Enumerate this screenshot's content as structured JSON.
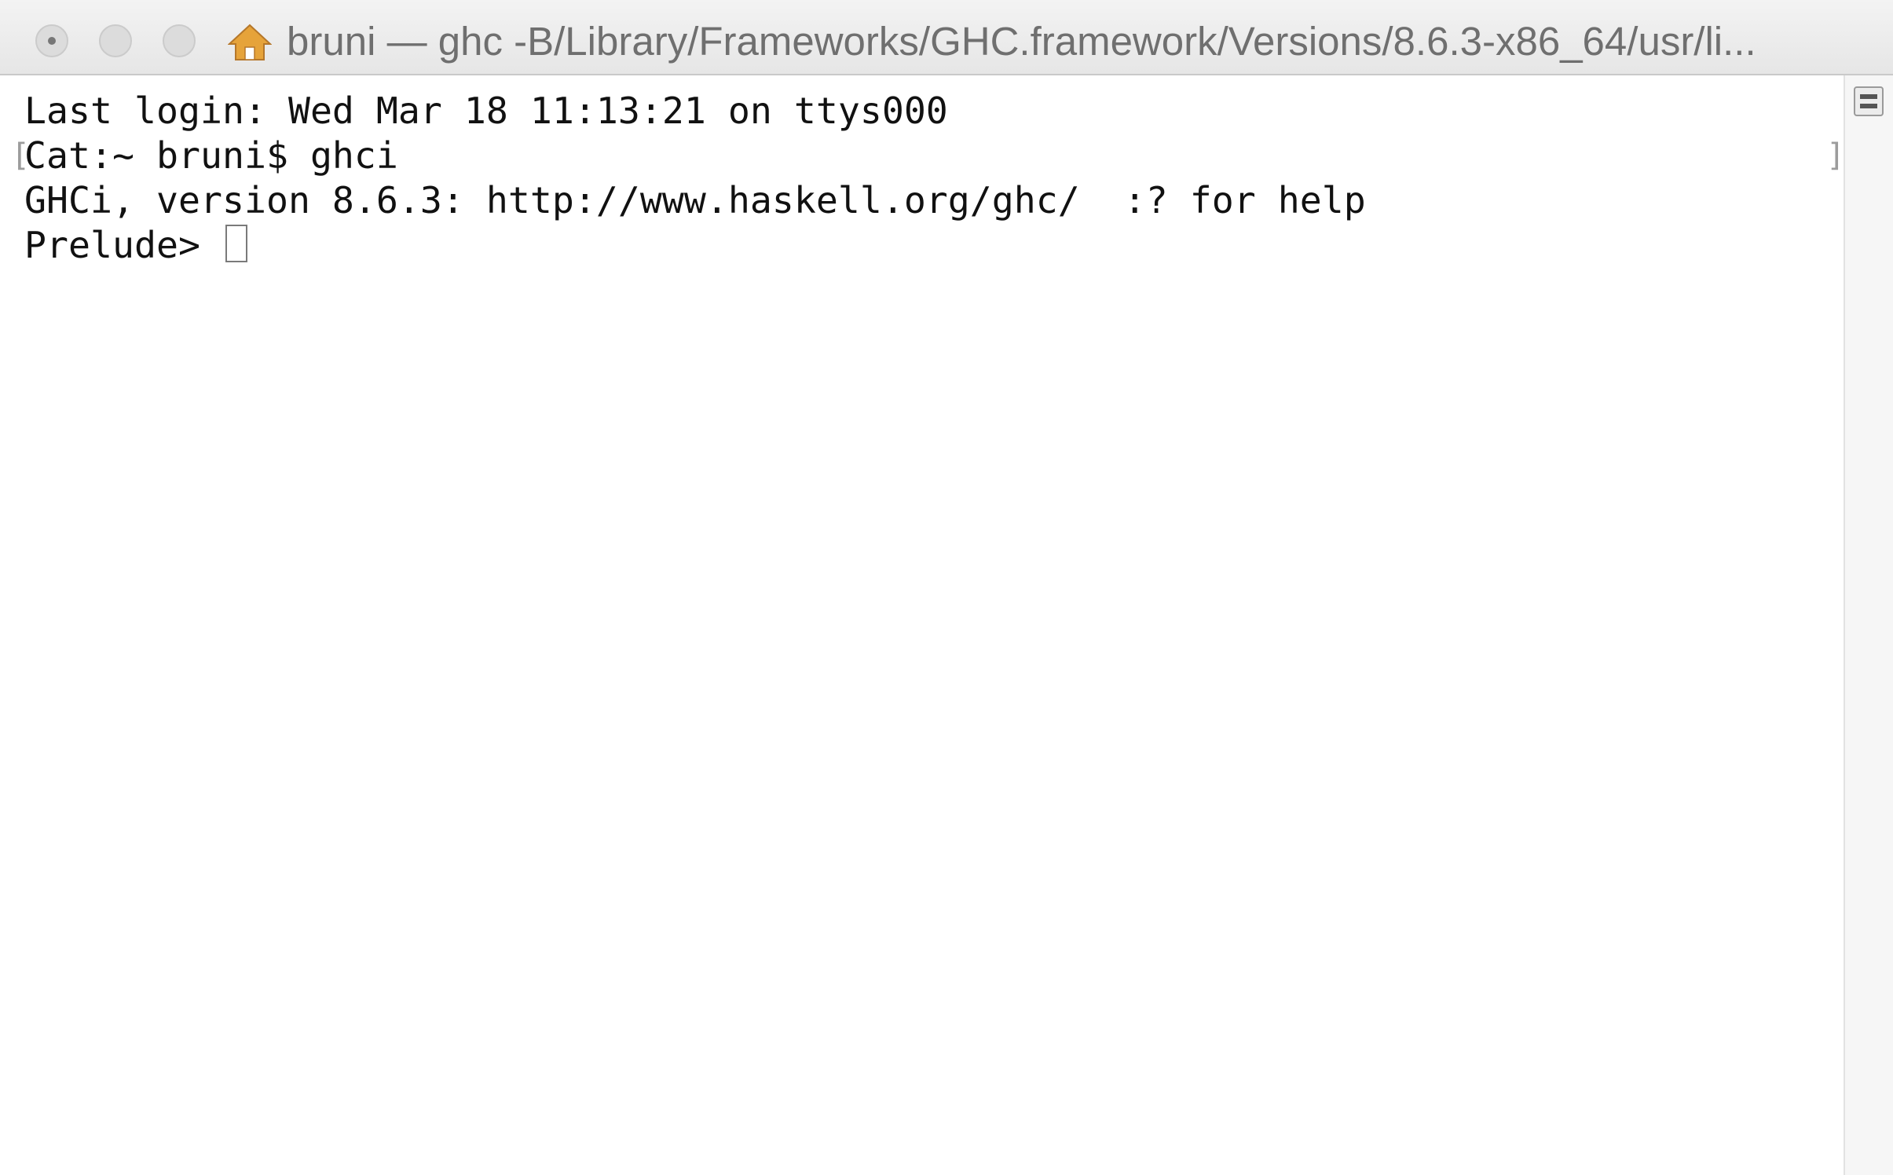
{
  "window": {
    "title": "bruni — ghc -B/Library/Frameworks/GHC.framework/Versions/8.6.3-x86_64/usr/li..."
  },
  "terminal": {
    "lines": [
      "Last login: Wed Mar 18 11:13:21 on ttys000",
      "Cat:~ bruni$ ghci",
      "GHCi, version 8.6.3: http://www.haskell.org/ghc/  :? for help",
      "Prelude> "
    ],
    "mark_left": "[",
    "mark_right": "]"
  },
  "icons": {
    "title_icon": "home-icon",
    "scroll_icon": "scroll-marks-icon"
  },
  "colors": {
    "text": "#111111",
    "title_text": "#6f6f6f",
    "background": "#ffffff"
  }
}
